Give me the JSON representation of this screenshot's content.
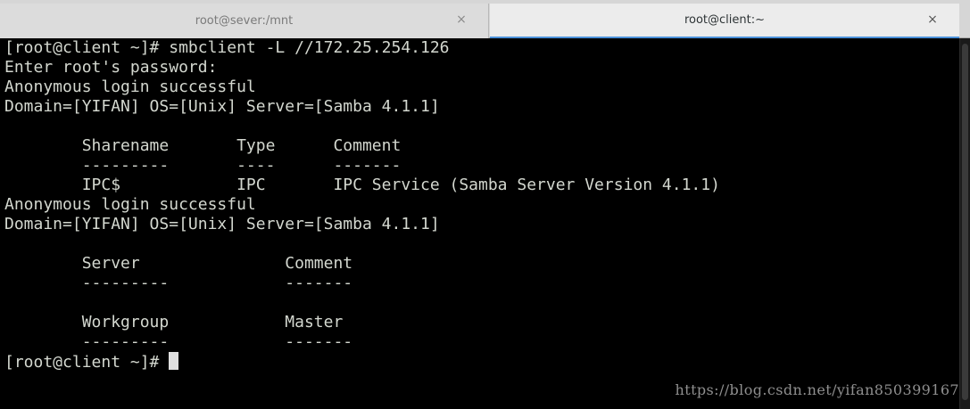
{
  "tabs": [
    {
      "label": "root@sever:/mnt",
      "close": "×"
    },
    {
      "label": "root@client:~",
      "close": "×"
    }
  ],
  "terminal": {
    "lines": [
      "[root@client ~]# smbclient -L //172.25.254.126",
      "Enter root's password:",
      "Anonymous login successful",
      "Domain=[YIFAN] OS=[Unix] Server=[Samba 4.1.1]",
      "",
      "        Sharename       Type      Comment",
      "        ---------       ----      -------",
      "        IPC$            IPC       IPC Service (Samba Server Version 4.1.1)",
      "Anonymous login successful",
      "Domain=[YIFAN] OS=[Unix] Server=[Samba 4.1.1]",
      "",
      "        Server               Comment",
      "        ---------            -------",
      "",
      "        Workgroup            Master",
      "        ---------            -------"
    ],
    "prompt": "[root@client ~]# "
  },
  "watermark": "https://blog.csdn.net/yifan850399167"
}
